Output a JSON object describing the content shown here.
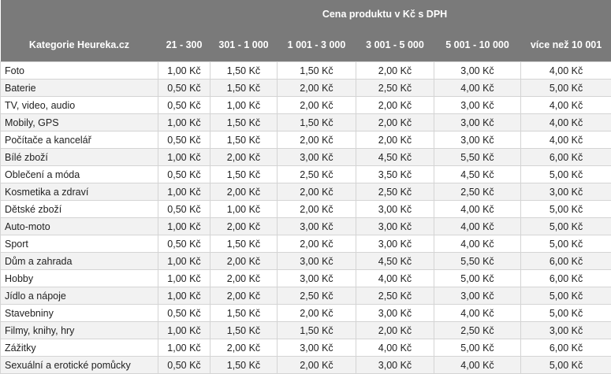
{
  "header": {
    "group_title": "Cena produktu v Kč s DPH",
    "category_label": "Kategorie Heureka.cz",
    "ranges": [
      "21 - 300",
      "301 - 1 000",
      "1 001 - 3 000",
      "3 001 - 5 000",
      "5 001 - 10 000",
      "více než 10 001"
    ]
  },
  "rows": [
    {
      "category": "Foto",
      "prices": [
        "1,00 Kč",
        "1,50 Kč",
        "1,50 Kč",
        "2,00 Kč",
        "3,00 Kč",
        "4,00 Kč"
      ]
    },
    {
      "category": "Baterie",
      "prices": [
        "0,50 Kč",
        "1,50 Kč",
        "2,00 Kč",
        "2,50 Kč",
        "4,00 Kč",
        "5,00 Kč"
      ]
    },
    {
      "category": "TV, video, audio",
      "prices": [
        "0,50 Kč",
        "1,00 Kč",
        "2,00 Kč",
        "2,00 Kč",
        "3,00 Kč",
        "4,00 Kč"
      ]
    },
    {
      "category": "Mobily, GPS",
      "prices": [
        "1,00 Kč",
        "1,50 Kč",
        "1,50 Kč",
        "2,00 Kč",
        "3,00 Kč",
        "4,00 Kč"
      ]
    },
    {
      "category": "Počítače a kancelář",
      "prices": [
        "0,50 Kč",
        "1,50 Kč",
        "2,00 Kč",
        "2,00 Kč",
        "3,00 Kč",
        "4,00 Kč"
      ]
    },
    {
      "category": "Bílé zboží",
      "prices": [
        "1,00 Kč",
        "2,00 Kč",
        "3,00 Kč",
        "4,50 Kč",
        "5,50 Kč",
        "6,00 Kč"
      ]
    },
    {
      "category": "Oblečení a móda",
      "prices": [
        "0,50 Kč",
        "1,50 Kč",
        "2,50 Kč",
        "3,50 Kč",
        "4,50 Kč",
        "5,00 Kč"
      ]
    },
    {
      "category": "Kosmetika a zdraví",
      "prices": [
        "1,00 Kč",
        "2,00 Kč",
        "2,00 Kč",
        "2,50 Kč",
        "2,50 Kč",
        "3,00 Kč"
      ]
    },
    {
      "category": "Dětské zboží",
      "prices": [
        "0,50 Kč",
        "1,00 Kč",
        "2,00 Kč",
        "3,00 Kč",
        "4,00 Kč",
        "5,00 Kč"
      ]
    },
    {
      "category": "Auto-moto",
      "prices": [
        "1,00 Kč",
        "2,00 Kč",
        "3,00 Kč",
        "3,00 Kč",
        "4,00 Kč",
        "5,00 Kč"
      ]
    },
    {
      "category": "Sport",
      "prices": [
        "0,50 Kč",
        "1,50 Kč",
        "2,00 Kč",
        "3,00 Kč",
        "4,00 Kč",
        "5,00 Kč"
      ]
    },
    {
      "category": "Dům a zahrada",
      "prices": [
        "1,00 Kč",
        "2,00 Kč",
        "3,00 Kč",
        "4,50 Kč",
        "5,50 Kč",
        "6,00 Kč"
      ]
    },
    {
      "category": "Hobby",
      "prices": [
        "1,00 Kč",
        "2,00 Kč",
        "3,00 Kč",
        "4,00 Kč",
        "5,00 Kč",
        "6,00 Kč"
      ]
    },
    {
      "category": "Jídlo a nápoje",
      "prices": [
        "1,00 Kč",
        "2,00 Kč",
        "2,50 Kč",
        "2,50 Kč",
        "3,00 Kč",
        "5,00 Kč"
      ]
    },
    {
      "category": "Stavebniny",
      "prices": [
        "0,50 Kč",
        "1,50 Kč",
        "2,00 Kč",
        "3,00 Kč",
        "4,00 Kč",
        "5,00 Kč"
      ]
    },
    {
      "category": "Filmy, knihy, hry",
      "prices": [
        "1,00 Kč",
        "1,50 Kč",
        "1,50 Kč",
        "2,00 Kč",
        "2,50 Kč",
        "3,00 Kč"
      ]
    },
    {
      "category": "Zážitky",
      "prices": [
        "1,00 Kč",
        "2,00 Kč",
        "3,00 Kč",
        "4,00 Kč",
        "5,00 Kč",
        "6,00 Kč"
      ]
    },
    {
      "category": "Sexuální a erotické pomůcky",
      "prices": [
        "0,50 Kč",
        "1,50 Kč",
        "2,00 Kč",
        "3,00 Kč",
        "4,00 Kč",
        "5,00 Kč"
      ]
    }
  ]
}
